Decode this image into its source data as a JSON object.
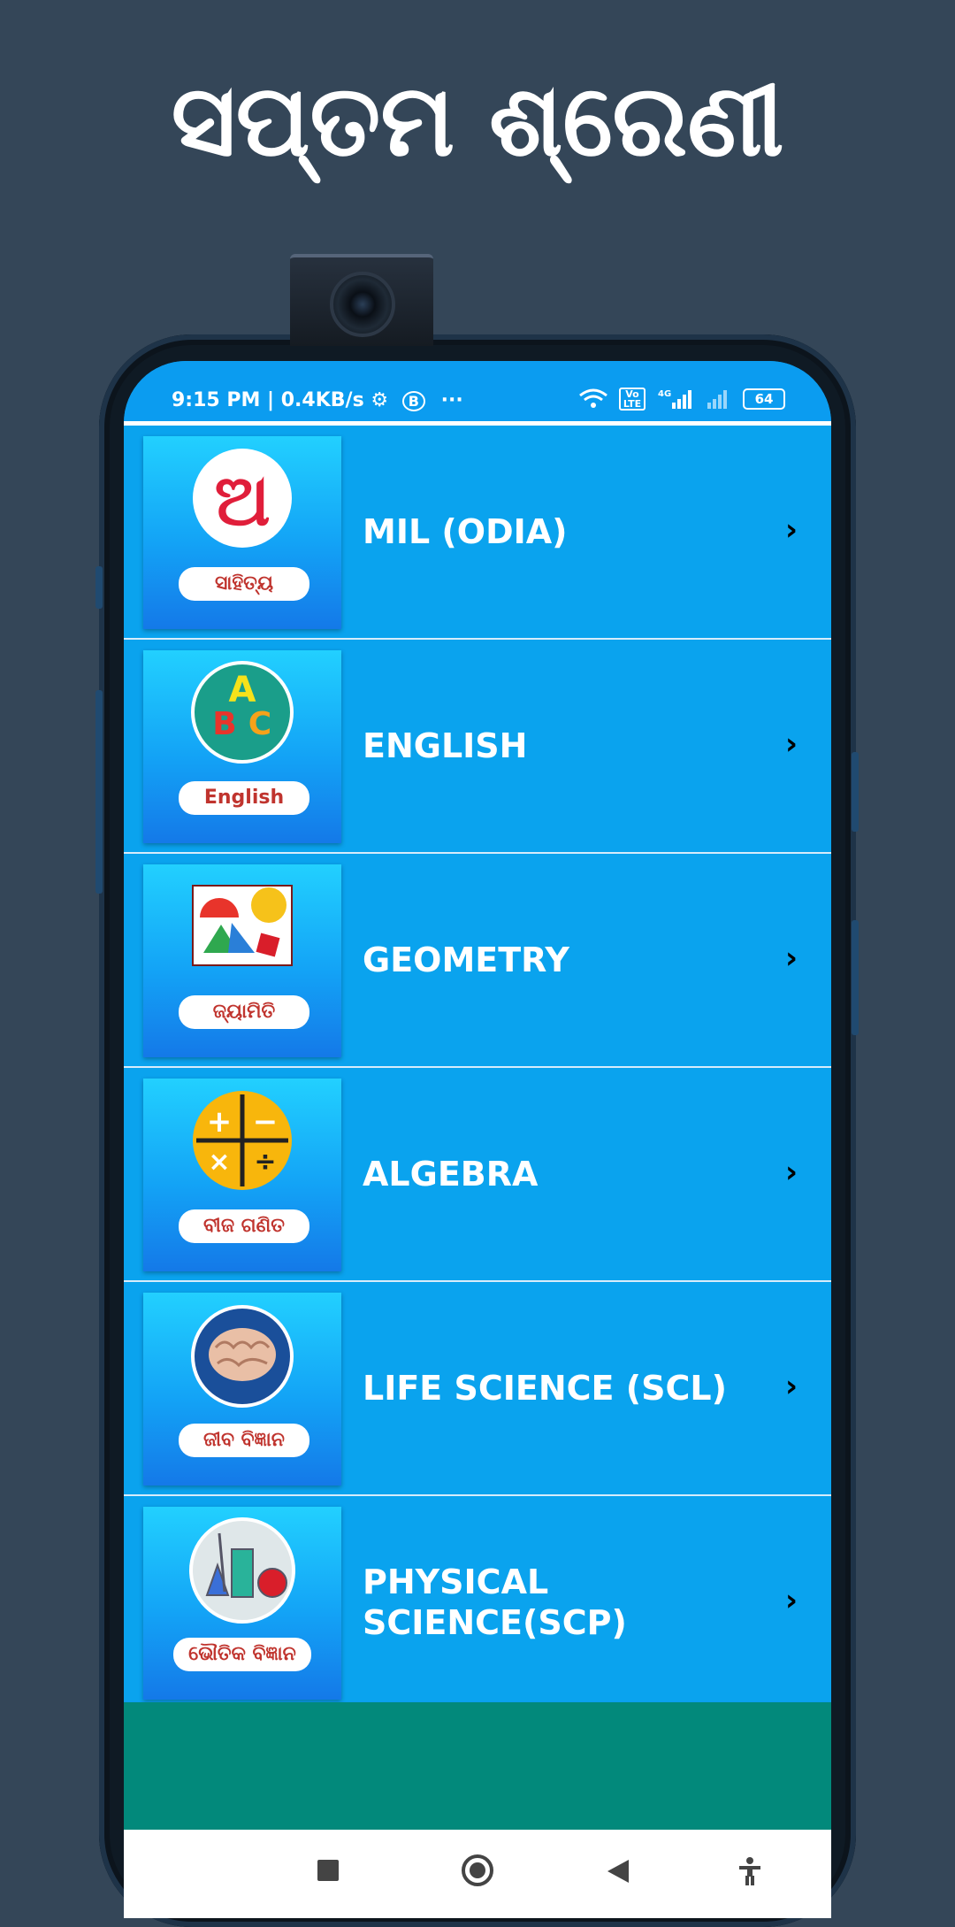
{
  "headline": "ସପ୍ତମ ଶ୍ରେଣୀ",
  "status_bar": {
    "time_text": "9:15 PM | 0.4KB/s",
    "battery": "64",
    "network": "4G",
    "volte": "Vo LTE"
  },
  "subjects": [
    {
      "title": "MIL (ODIA)",
      "thumb_label": "ସାହିତ୍ୟ",
      "icon": "odia-letter-icon"
    },
    {
      "title": "ENGLISH",
      "thumb_label": "English",
      "icon": "abc-globe-icon"
    },
    {
      "title": "GEOMETRY",
      "thumb_label": "ଜ୍ୟାମିତି",
      "icon": "shapes-icon"
    },
    {
      "title": "ALGEBRA",
      "thumb_label": "ବୀଜ ଗଣିତ",
      "icon": "math-operators-icon"
    },
    {
      "title": "LIFE SCIENCE (SCL)",
      "thumb_label": "ଜୀବ ବିଜ୍ଞାନ",
      "icon": "brain-icon"
    },
    {
      "title": "PHYSICAL SCIENCE(SCP)",
      "thumb_label": "ଭୌତିକ ବିଜ୍ଞାନ",
      "icon": "lab-flasks-icon"
    }
  ],
  "thumb_glyph": "ଅ",
  "colors": {
    "background": "#344658",
    "list_blue": "#0aa3ee",
    "teal": "#02897b"
  }
}
